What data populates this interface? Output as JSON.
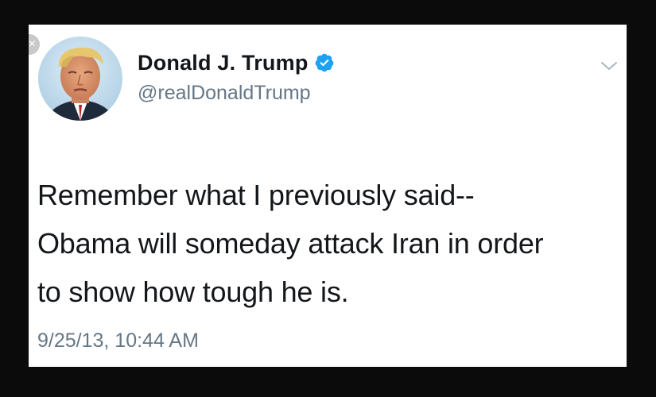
{
  "tweet": {
    "display_name": "Donald J. Trump",
    "handle": "@realDonaldTrump",
    "text_lines": [
      "Remember what I previously said--",
      "Obama will someday attack Iran in order",
      "to show how tough he is."
    ],
    "timestamp": "9/25/13, 10:44 AM"
  },
  "ui": {
    "close_glyph": "×",
    "verified_icon": "verified-badge-icon",
    "menu_icon": "chevron-down-icon"
  },
  "colors": {
    "text_primary": "#14171a",
    "text_secondary": "#657786",
    "verified_blue": "#1da1f2",
    "background": "#ffffff",
    "frame": "#0b0b0b"
  }
}
